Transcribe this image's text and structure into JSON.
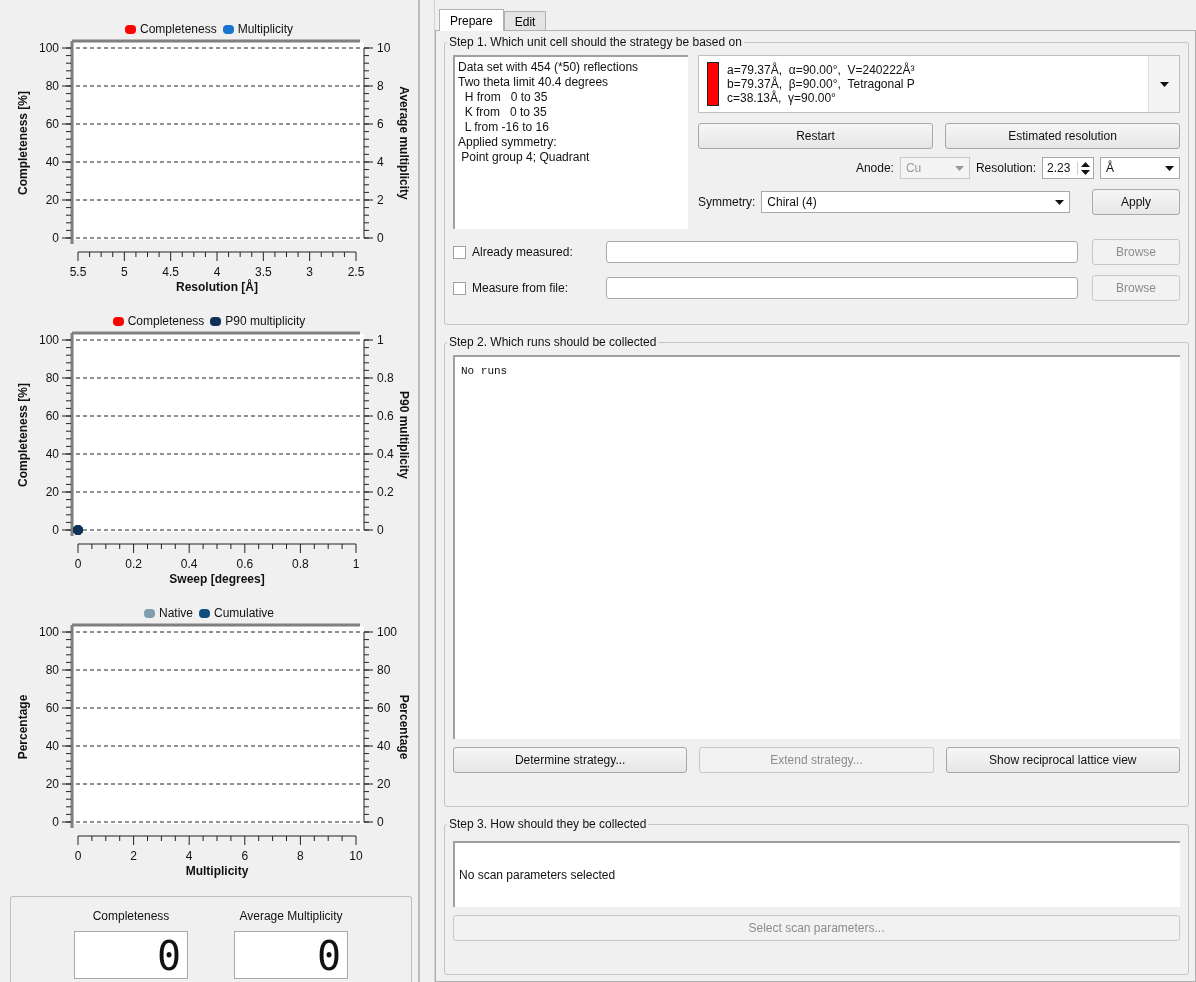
{
  "charts": [
    {
      "chart_data": {
        "type": "scatter",
        "xlabel": "Resolution [Å]",
        "ylabel": "Completeness [%]",
        "y2label": "Average multiplicity",
        "grid": true,
        "categories": [
          "5.5",
          "5",
          "4.5",
          "4",
          "3.5",
          "3",
          "2.5"
        ],
        "ylim": [
          0,
          100
        ],
        "y2lim": [
          0,
          10
        ],
        "yticks": [
          0,
          20,
          40,
          60,
          80,
          100
        ],
        "y2ticks": [
          0,
          2,
          4,
          6,
          8,
          10
        ],
        "series": [
          {
            "name": "Completeness",
            "color": "#ff0000",
            "values": [
              null,
              null,
              null,
              null,
              null,
              null,
              null
            ]
          },
          {
            "name": "Multiplicity",
            "color": "#1874cd",
            "values": [
              null,
              null,
              null,
              null,
              null,
              null,
              null
            ]
          }
        ]
      }
    },
    {
      "chart_data": {
        "type": "scatter",
        "xlabel": "Sweep [degrees]",
        "ylabel": "Completeness [%]",
        "y2label": "P90 multiplicity",
        "grid": true,
        "xlim": [
          0,
          1
        ],
        "ylim": [
          0,
          100
        ],
        "y2lim": [
          0,
          1
        ],
        "xticks": [
          0,
          0.2,
          0.4,
          0.6,
          0.8,
          1
        ],
        "yticks": [
          0,
          20,
          40,
          60,
          80,
          100
        ],
        "y2ticks": [
          0,
          0.2,
          0.4,
          0.6,
          0.8,
          1
        ],
        "x": [
          0
        ],
        "series": [
          {
            "name": "Completeness",
            "color": "#ff0000",
            "values": [
              null
            ]
          },
          {
            "name": "P90 multiplicity",
            "color": "#0f3057",
            "values": [
              0
            ]
          }
        ]
      }
    },
    {
      "chart_data": {
        "type": "scatter",
        "xlabel": "Multiplicity",
        "ylabel": "Percentage",
        "y2label": "Percentage",
        "grid": true,
        "categories": [
          "0",
          "2",
          "4",
          "6",
          "8",
          "10"
        ],
        "ylim": [
          0,
          100
        ],
        "y2lim": [
          0,
          100
        ],
        "yticks": [
          0,
          20,
          40,
          60,
          80,
          100
        ],
        "y2ticks": [
          0,
          20,
          40,
          60,
          80,
          100
        ],
        "series": [
          {
            "name": "Native",
            "color": "#7f9fb0",
            "values": [
              null,
              null,
              null,
              null,
              null,
              null
            ]
          },
          {
            "name": "Cumulative",
            "color": "#104e80",
            "values": [
              null,
              null,
              null,
              null,
              null,
              null
            ]
          }
        ]
      }
    }
  ],
  "summary": [
    {
      "label": "Completeness",
      "value": "0"
    },
    {
      "label": "Average Multiplicity",
      "value": "0"
    }
  ],
  "tabs": [
    {
      "label": "Prepare",
      "selected": true
    },
    {
      "label": "Edit",
      "selected": false
    }
  ],
  "step1": {
    "title": "Step 1. Which unit cell should the strategy be based on",
    "info_lines": [
      "Data set with 454 (*50) reflections",
      "Two theta limit 40.4 degrees",
      "  H from   0 to 35",
      "  K from   0 to 35",
      "  L from -16 to 16",
      "Applied symmetry:",
      " Point group 4; Quadrant"
    ],
    "cell": {
      "color": "#ff0000",
      "lines": [
        "a=79.37Å,  α=90.00°,  V=240222Å³",
        "b=79.37Å,  β=90.00°,  Tetragonal P",
        "c=38.13Å,  γ=90.00°"
      ]
    },
    "buttons": [
      {
        "label": "Restart",
        "disabled": false
      },
      {
        "label": "Estimated resolution",
        "disabled": false
      }
    ],
    "anode": {
      "label": "Anode:",
      "value": "Cu",
      "disabled": true
    },
    "resolution": {
      "label": "Resolution:",
      "value": "2.23"
    },
    "unit": {
      "value": "Å"
    },
    "symmetry": {
      "label": "Symmetry:",
      "value": "Chiral (4)"
    },
    "apply": {
      "label": "Apply",
      "disabled": false
    },
    "file_rows": [
      {
        "label": "Already measured:",
        "checked": false,
        "button": "Browse",
        "button_disabled": true
      },
      {
        "label": "Measure from file:",
        "checked": false,
        "button": "Browse",
        "button_disabled": true
      }
    ]
  },
  "step2": {
    "title": "Step 2. Which runs should be collected",
    "runs_text": "No runs",
    "buttons": [
      {
        "label": "Determine strategy...",
        "disabled": false
      },
      {
        "label": "Extend strategy...",
        "disabled": true
      },
      {
        "label": "Show reciprocal lattice view",
        "disabled": false
      }
    ]
  },
  "step3": {
    "title": "Step 3. How should they be collected",
    "text": "No scan parameters selected",
    "button": {
      "label": "Select scan parameters...",
      "disabled": true
    }
  }
}
